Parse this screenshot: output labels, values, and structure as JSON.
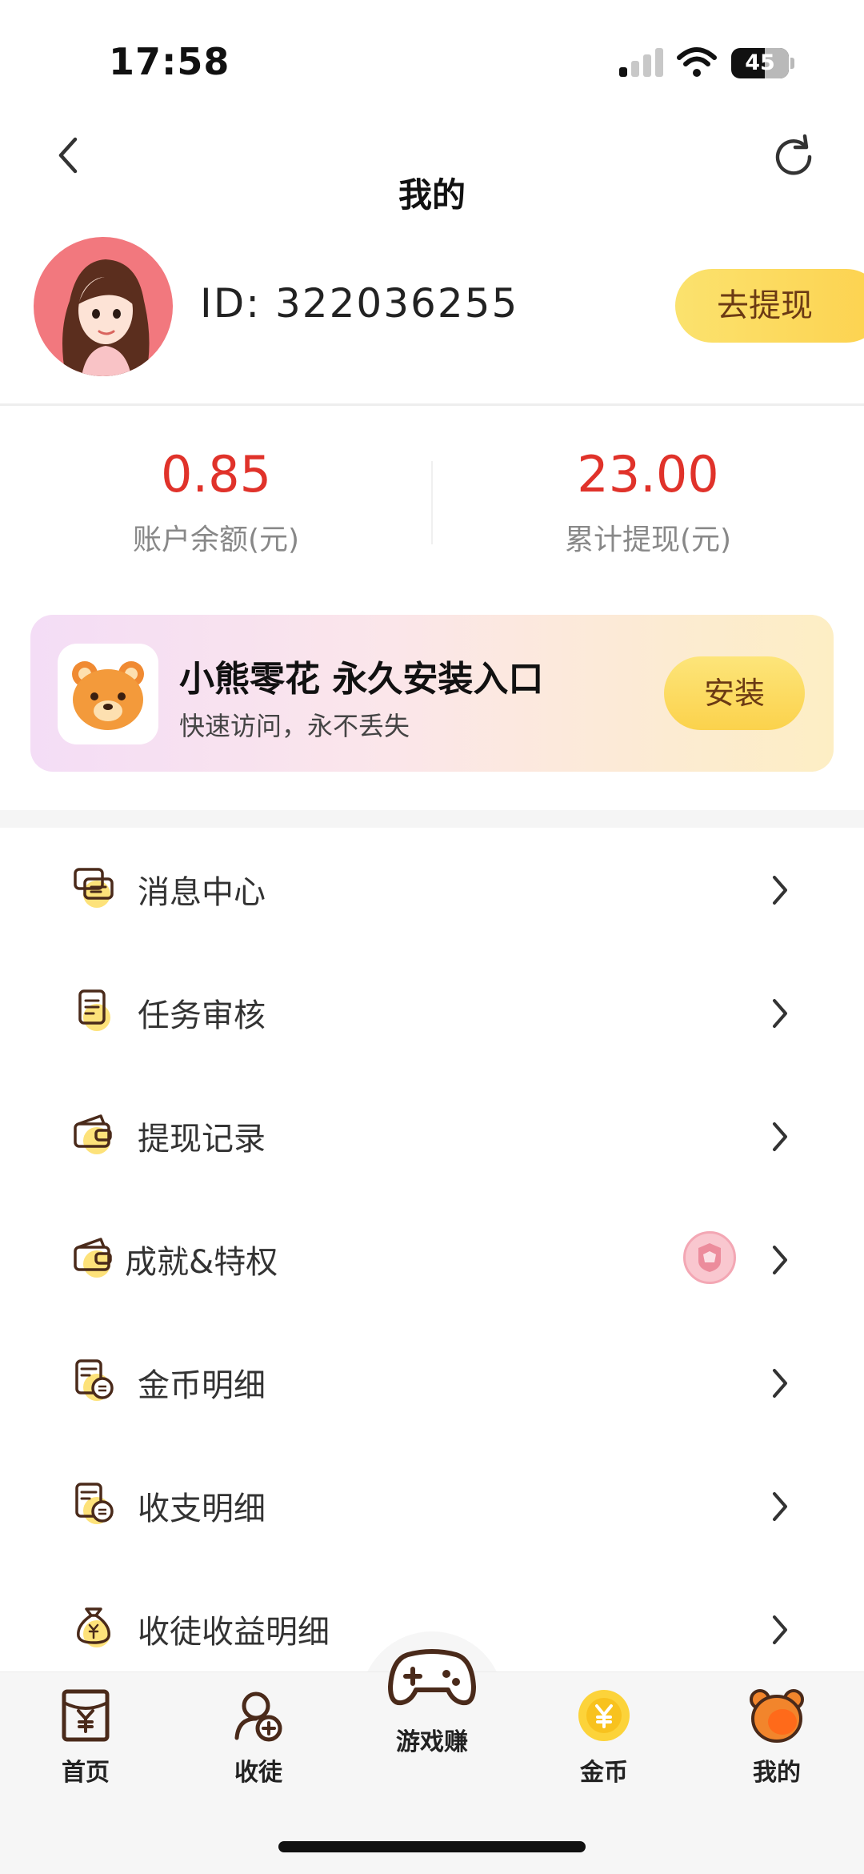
{
  "status_bar": {
    "time": "17:58",
    "battery": "45"
  },
  "nav": {
    "title": "我的"
  },
  "profile": {
    "id_text": "ID: 322036255",
    "withdraw_label": "去提现"
  },
  "stats": [
    {
      "value": "0.85",
      "label": "账户余额(元)"
    },
    {
      "value": "23.00",
      "label": "累计提现(元)"
    }
  ],
  "promo": {
    "title": "小熊零花 永久安装入口",
    "subtitle": "快速访问，永不丢失",
    "button": "安装"
  },
  "menu": [
    {
      "label": "消息中心",
      "icon": "message-icon"
    },
    {
      "label": "任务审核",
      "icon": "task-review-icon"
    },
    {
      "label": "提现记录",
      "icon": "wallet-icon"
    },
    {
      "label": "成就&特权",
      "icon": "wallet-icon"
    },
    {
      "label": "金币明细",
      "icon": "coin-detail-icon"
    },
    {
      "label": "收支明细",
      "icon": "income-detail-icon"
    },
    {
      "label": "收徒收益明细",
      "icon": "money-bag-icon"
    }
  ],
  "tabs": [
    {
      "label": "首页",
      "icon": "home-icon"
    },
    {
      "label": "收徒",
      "icon": "recruit-icon"
    },
    {
      "label": "游戏赚",
      "icon": "gamepad-icon"
    },
    {
      "label": "金币",
      "icon": "gold-coin-icon"
    },
    {
      "label": "我的",
      "icon": "bear-icon"
    }
  ],
  "colors": {
    "accent_red": "#e0322a",
    "button_yellow": "#fdd24f",
    "button_text": "#6b3a14"
  }
}
